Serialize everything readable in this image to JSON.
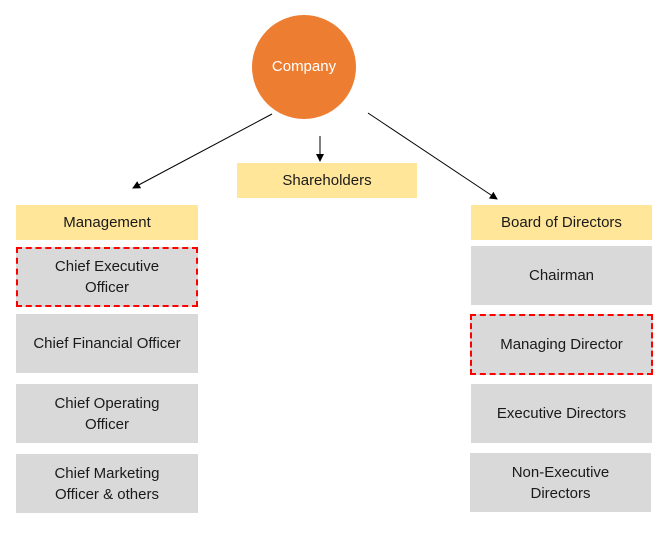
{
  "root": {
    "label": "Company",
    "color": "#ED7D31"
  },
  "shareholders": {
    "label": "Shareholders"
  },
  "management": {
    "header": "Management",
    "items": [
      {
        "label": "Chief Executive Officer",
        "lines": [
          "Chief Executive",
          "Officer"
        ],
        "highlighted": true
      },
      {
        "label": "Chief Financial Officer",
        "lines": [
          "Chief Financial Officer"
        ],
        "highlighted": false
      },
      {
        "label": "Chief Operating Officer",
        "lines": [
          "Chief Operating",
          "Officer"
        ],
        "highlighted": false
      },
      {
        "label": "Chief Marketing Officer & others",
        "lines": [
          "Chief Marketing",
          "Officer & others"
        ],
        "highlighted": false
      }
    ]
  },
  "board": {
    "header": "Board of Directors",
    "items": [
      {
        "label": "Chairman",
        "lines": [
          "Chairman"
        ],
        "highlighted": false
      },
      {
        "label": "Managing Director",
        "lines": [
          "Managing Director"
        ],
        "highlighted": true
      },
      {
        "label": "Executive Directors",
        "lines": [
          "Executive Directors"
        ],
        "highlighted": false
      },
      {
        "label": "Non-Executive Directors",
        "lines": [
          "Non-Executive",
          "Directors"
        ],
        "highlighted": false
      }
    ]
  },
  "colors": {
    "header_fill": "#FFE699",
    "item_fill": "#D9D9D9",
    "highlight_border": "#FF0000"
  }
}
